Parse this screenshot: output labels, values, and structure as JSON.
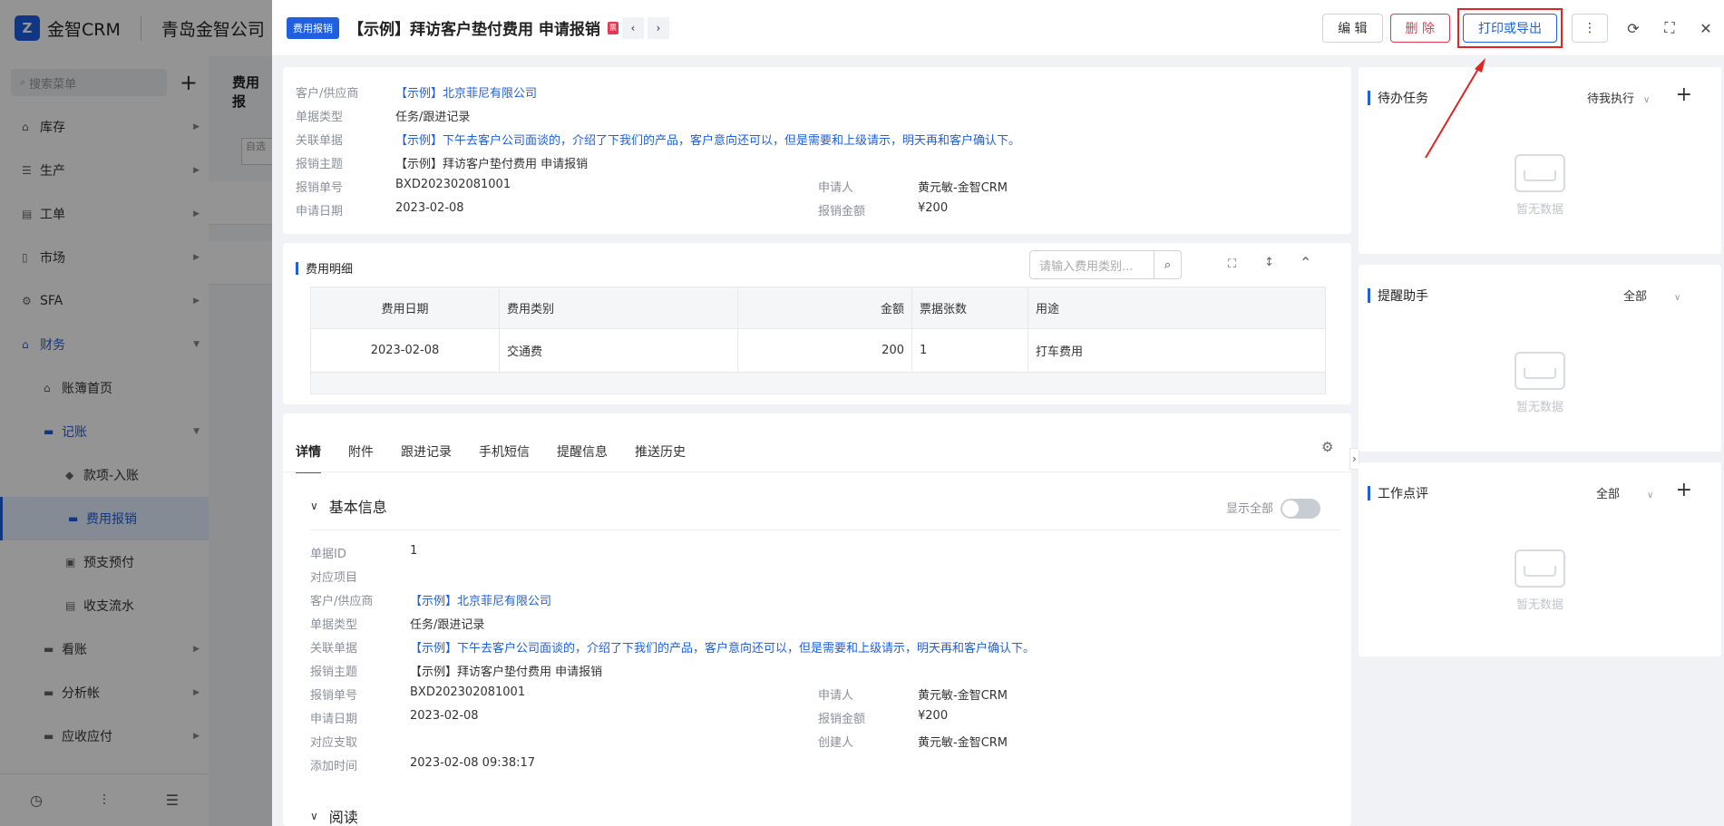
{
  "app": {
    "logo": "Z",
    "brand": "金智CRM",
    "company": "青岛金智公司"
  },
  "sidebar": {
    "search_placeholder": "搜索菜单",
    "add": "+",
    "items": [
      {
        "label": "库存",
        "icon": "home-icon"
      },
      {
        "label": "生产",
        "icon": "factory-icon"
      },
      {
        "label": "工单",
        "icon": "ticket-icon"
      },
      {
        "label": "市场",
        "icon": "market-icon"
      },
      {
        "label": "SFA",
        "icon": "sfa-icon"
      },
      {
        "label": "财务",
        "icon": "finance-icon"
      },
      {
        "label": "账簿首页",
        "icon": "home-icon"
      },
      {
        "label": "记账",
        "icon": "folder-icon"
      },
      {
        "label": "款项-入账",
        "icon": "receipt-icon"
      },
      {
        "label": "费用报销",
        "icon": "card-icon"
      },
      {
        "label": "预支预付",
        "icon": "wallet-icon"
      },
      {
        "label": "收支流水",
        "icon": "flow-icon"
      },
      {
        "label": "看账",
        "icon": "folder-icon"
      },
      {
        "label": "分析帐",
        "icon": "folder-icon"
      },
      {
        "label": "应收应付",
        "icon": "folder-icon"
      }
    ]
  },
  "background_page": {
    "title": "费用报",
    "filter_text": "自选"
  },
  "header": {
    "badge": "费用报销",
    "title": "【示例】拜访客户垫付费用 申请报销",
    "red_tag": "票",
    "prev": "‹",
    "next": "›",
    "edit": "编 辑",
    "delete": "删 除",
    "print_export": "打印或导出",
    "more": "⋮",
    "refresh_icon": "⟳",
    "fullscreen_icon": "⛶",
    "close_icon": "✕"
  },
  "summary": {
    "fields": [
      {
        "label": "客户/供应商",
        "value": "【示例】北京菲尼有限公司",
        "link": true
      },
      {
        "label": "单据类型",
        "value": "任务/跟进记录"
      },
      {
        "label": "关联单据",
        "value": "【示例】下午去客户公司面谈的，介绍了下我们的产品，客户意向还可以，但是需要和上级请示，明天再和客户确认下。",
        "link": true
      },
      {
        "label": "报销主题",
        "value": "【示例】拜访客户垫付费用 申请报销"
      },
      {
        "label": "报销单号",
        "value": "BXD202302081001"
      },
      {
        "label": "申请日期",
        "value": "2023-02-08"
      }
    ],
    "right_fields": [
      {
        "label": "申请人",
        "value": "黄元敏-金智CRM"
      },
      {
        "label": "报销金额",
        "value": "¥200"
      }
    ]
  },
  "fee_detail": {
    "title": "费用明细",
    "search_placeholder": "请输入费用类别...",
    "columns": [
      "费用日期",
      "费用类别",
      "金额",
      "票据张数",
      "用途"
    ],
    "rows": [
      [
        "2023-02-08",
        "交通费",
        "200",
        "1",
        "打车费用"
      ]
    ]
  },
  "tabs": [
    "详情",
    "附件",
    "跟进记录",
    "手机短信",
    "提醒信息",
    "推送历史"
  ],
  "basic_info": {
    "title": "基本信息",
    "show_all": "显示全部",
    "fields": [
      {
        "label": "单据ID",
        "value": "1"
      },
      {
        "label": "对应项目",
        "value": ""
      },
      {
        "label": "客户/供应商",
        "value": "【示例】北京菲尼有限公司",
        "link": true
      },
      {
        "label": "单据类型",
        "value": "任务/跟进记录"
      },
      {
        "label": "关联单据",
        "value": "【示例】下午去客户公司面谈的，介绍了下我们的产品，客户意向还可以，但是需要和上级请示，明天再和客户确认下。",
        "link": true
      },
      {
        "label": "报销主题",
        "value": "【示例】拜访客户垫付费用 申请报销"
      },
      {
        "label": "报销单号",
        "value": "BXD202302081001"
      },
      {
        "label": "申请日期",
        "value": "2023-02-08"
      },
      {
        "label": "对应支取",
        "value": ""
      },
      {
        "label": "添加时间",
        "value": "2023-02-08 09:38:17"
      }
    ],
    "right_fields": [
      {
        "label": "申请人",
        "value": "黄元敏-金智CRM"
      },
      {
        "label": "报销金额",
        "value": "¥200"
      },
      {
        "label": "创建人",
        "value": "黄元敏-金智CRM"
      }
    ],
    "next_section": "阅读"
  },
  "right_panels": [
    {
      "title": "待办任务",
      "filter": "待我执行",
      "plus": "+",
      "empty": "暂无数据"
    },
    {
      "title": "提醒助手",
      "filter": "全部",
      "plus": "",
      "empty": "暂无数据"
    },
    {
      "title": "工作点评",
      "filter": "全部",
      "plus": "+",
      "empty": "暂无数据"
    }
  ],
  "colors": {
    "accent": "#1f5fe0",
    "danger": "#e8384f",
    "highlight": "#e02424"
  }
}
